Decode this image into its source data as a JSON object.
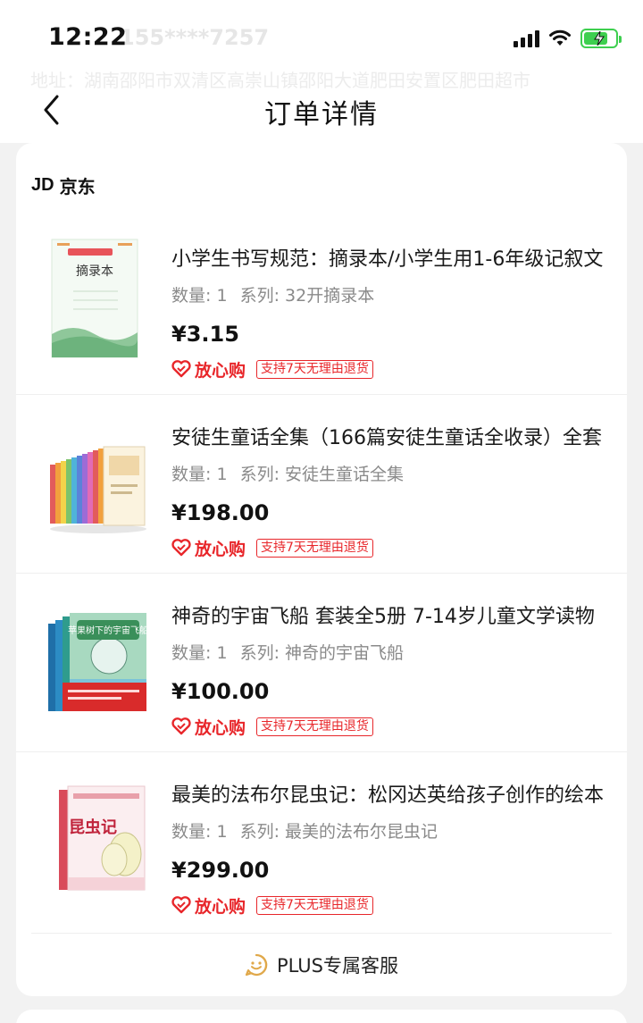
{
  "status_bar": {
    "time": "12:22",
    "ghost_phone": "155****7257",
    "ghost_address": "地址：湖南邵阳市双清区高崇山镇邵阳大道肥田安置区肥田超市"
  },
  "nav": {
    "title": "订单详情"
  },
  "shop": {
    "logo": "JD",
    "name": "京东"
  },
  "products": [
    {
      "title": "小学生书写规范：摘录本/小学生用1-6年级记叙文",
      "quantity_label": "数量: 1",
      "series_label": "系列: 32开摘录本",
      "price": "¥3.15",
      "cover_text": "摘录本"
    },
    {
      "title": "安徒生童话全集（166篇安徒生童话全收录）全套",
      "quantity_label": "数量: 1",
      "series_label": "系列: 安徒生童话全集",
      "price": "¥198.00"
    },
    {
      "title": "神奇的宇宙飞船 套装全5册 7-14岁儿童文学读物",
      "quantity_label": "数量: 1",
      "series_label": "系列: 神奇的宇宙飞船",
      "price": "¥100.00",
      "cover_text": "苹果树下的宇宙飞船"
    },
    {
      "title": "最美的法布尔昆虫记：松冈达英给孩子创作的绘本",
      "quantity_label": "数量: 1",
      "series_label": "系列: 最美的法布尔昆虫记",
      "price": "¥299.00",
      "cover_text": "昆虫记"
    }
  ],
  "guarantee": {
    "name": "放心购",
    "tag": "支持7天无理由退货"
  },
  "service": {
    "label": "PLUS专属客服",
    "icon": "smile-chat-icon"
  },
  "colors": {
    "accent_red": "#e8262a",
    "battery_green": "#3ecf4f",
    "plus_gold": "#e0a84a"
  }
}
